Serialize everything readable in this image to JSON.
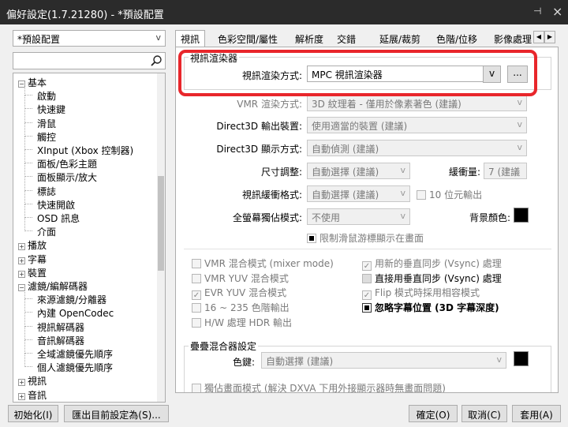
{
  "window": {
    "title": "偏好設定(1.7.21280) - *預設配置",
    "pin_glyph": "⊣",
    "close_glyph": "×"
  },
  "profile": {
    "value": "*預設配置",
    "arrow": "v"
  },
  "search": {
    "value": "",
    "icon": "magnifier-icon"
  },
  "tree": [
    {
      "label": "基本",
      "level": 0,
      "expander": "−"
    },
    {
      "label": "啟動",
      "level": 1
    },
    {
      "label": "快速鍵",
      "level": 1
    },
    {
      "label": "滑鼠",
      "level": 1
    },
    {
      "label": "觸控",
      "level": 1
    },
    {
      "label": "XInput (Xbox 控制器)",
      "level": 1
    },
    {
      "label": "面板/色彩主題",
      "level": 1
    },
    {
      "label": "面板顯示/放大",
      "level": 1
    },
    {
      "label": "標誌",
      "level": 1
    },
    {
      "label": "快速開啟",
      "level": 1
    },
    {
      "label": "OSD 訊息",
      "level": 1
    },
    {
      "label": "介面",
      "level": 1
    },
    {
      "label": "播放",
      "level": 0,
      "expander": "+"
    },
    {
      "label": "字幕",
      "level": 0,
      "expander": "+"
    },
    {
      "label": "裝置",
      "level": 0,
      "expander": "+"
    },
    {
      "label": "濾鏡/編解碼器",
      "level": 0,
      "expander": "−"
    },
    {
      "label": "來源濾鏡/分離器",
      "level": 1
    },
    {
      "label": "內建 OpenCodec",
      "level": 1
    },
    {
      "label": "視訊解碼器",
      "level": 1
    },
    {
      "label": "音訊解碼器",
      "level": 1
    },
    {
      "label": "全域濾鏡優先順序",
      "level": 1
    },
    {
      "label": "個人濾鏡優先順序",
      "level": 1
    },
    {
      "label": "視訊",
      "level": 0,
      "expander": "+"
    },
    {
      "label": "音訊",
      "level": 0,
      "expander": "+"
    }
  ],
  "tabs": [
    "視訊",
    "色彩空間/屬性",
    "解析度",
    "交錯",
    "延展/裁剪",
    "色階/位移",
    "影像處理"
  ],
  "tab_nav": {
    "prev": "◀",
    "next": "▶"
  },
  "renderer": {
    "group_title": "視訊渲染器",
    "label": "視訊渲染方式:",
    "value": "MPC 視訊渲染器",
    "arrow": "v",
    "more_button": "..."
  },
  "form": {
    "vmr_mode": {
      "label": "VMR 渲染方式:",
      "value": "3D 紋理着 - 僅用於像素著色 (建議)"
    },
    "d3d_output": {
      "label": "Direct3D 輸出裝置:",
      "value": "使用適當的裝置 (建議)"
    },
    "d3d_display": {
      "label": "Direct3D 顯示方式:",
      "value": "自動偵測 (建議)"
    },
    "resize": {
      "label": "尺寸調整:",
      "value": "自動選擇 (建議)"
    },
    "buffer": {
      "label": "緩衝量:",
      "value": "7 (建議"
    },
    "buffer_format": {
      "label": "視訊緩衝格式:",
      "value": "自動選擇 (建議)"
    },
    "ten_bit": "10 位元輸出",
    "fullscreen_exclusive": {
      "label": "全螢幕獨佔模式:",
      "value": "不使用"
    },
    "bg_color": {
      "label": "背景顏色:",
      "color": "#000000"
    },
    "limit_cursor": "限制滑鼠游標顯示在畫面"
  },
  "checks_left": [
    "VMR 混合模式 (mixer mode)",
    "VMR YUV 混合模式",
    "EVR YUV 混合模式",
    "16 ~ 235 色階輸出",
    "H/W 處理 HDR 輸出"
  ],
  "checks_right": [
    "用新的垂直同步 (Vsync) 處理",
    "直接用垂直同步 (Vsync) 處理",
    "Flip 模式時採用相容模式",
    "忽略字幕位置 (3D 字幕深度)"
  ],
  "overlay": {
    "group_title": "疊疊混合器設定",
    "color_key_label": "色鍵:",
    "color_key_value": "自動選擇 (建議)",
    "color": "#000000",
    "exclusive_mode": "獨佔畫面模式 (解決 DXVA 下用外接顯示器時無畫面問題)"
  },
  "footer": {
    "reset": "初始化(I)",
    "export": "匯出目前設定為(S)...",
    "ok": "確定(O)",
    "cancel": "取消(C)",
    "apply": "套用(A)"
  }
}
